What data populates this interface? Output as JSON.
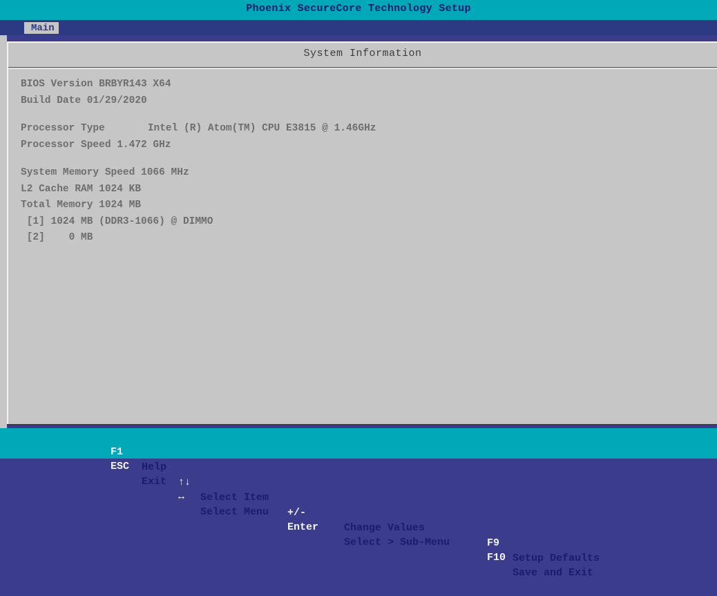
{
  "window": {
    "title": "Phoenix SecureCore Technology Setup"
  },
  "menu": {
    "tabs": [
      "Main"
    ]
  },
  "panel": {
    "header": "System Information",
    "lines": {
      "bios_version": "BIOS Version BRBYR143 X64",
      "build_date": "Build Date 01/29/2020",
      "processor_type_label": "Processor Type",
      "processor_type_value": "Intel (R) Atom(TM) CPU E3815 @ 1.46GHz",
      "processor_speed": "Processor Speed 1.472 GHz",
      "memory_speed": "System Memory Speed 1066 MHz",
      "l2_cache": "L2 Cache RAM 1024 KB",
      "total_memory": "Total Memory 1024 MB",
      "slot1": " [1] 1024 MB (DDR3-1066) @ DIMMO",
      "slot2": " [2]    0 MB"
    }
  },
  "status_bar": {
    "row1": [
      {
        "key": "F1",
        "desc": "Help"
      },
      {
        "key": "↑↓",
        "desc": "Select Item"
      },
      {
        "key": "+/-",
        "desc": "Change Values"
      },
      {
        "key": "F9",
        "desc": "Setup Defaults"
      }
    ],
    "row2": [
      {
        "key": "ESC",
        "desc": "Exit"
      },
      {
        "key": "↔",
        "desc": "Select Menu"
      },
      {
        "key": "Enter",
        "desc": "Select > Sub-Menu"
      },
      {
        "key": "F10",
        "desc": "Save and Exit"
      }
    ]
  },
  "colors": {
    "title_bar": "#00a8b8",
    "menu_bar": "#2b3a83",
    "panel": "#c6c6c6",
    "text_gray": "#6e6e6e",
    "key_white": "#f5f5f5",
    "text_blue": "#1b1b70"
  }
}
